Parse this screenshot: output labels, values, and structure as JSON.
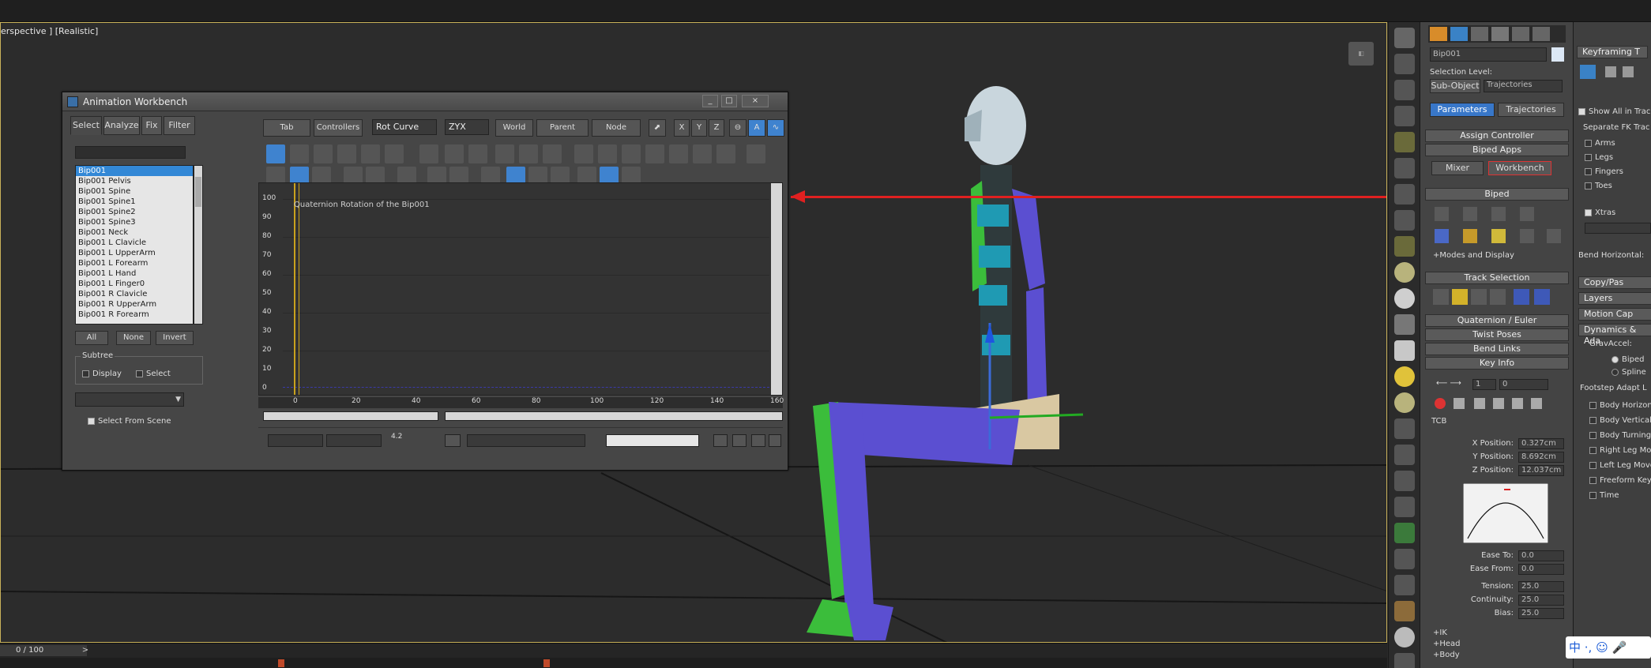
{
  "viewport": {
    "label": "erspective ] [Realistic]"
  },
  "workbench": {
    "title": "Animation Workbench",
    "window_buttons": [
      "_",
      "□",
      "×"
    ],
    "left_tabs": [
      "Select",
      "Analyze",
      "Fix",
      "Filter"
    ],
    "bones": [
      "Bip001",
      "Bip001 Pelvis",
      "Bip001 Spine",
      "Bip001 Spine1",
      "Bip001 Spine2",
      "Bip001 Spine3",
      "Bip001 Neck",
      "Bip001 L Clavicle",
      "Bip001 L UpperArm",
      "Bip001 L Forearm",
      "Bip001 L Hand",
      "Bip001 L Finger0",
      "Bip001 R Clavicle",
      "Bip001 R UpperArm",
      "Bip001 R Forearm"
    ],
    "list_buttons": {
      "all": "All",
      "none": "None",
      "invert": "Invert"
    },
    "subtree": {
      "caption": "Subtree",
      "display": "Display",
      "select": "Select"
    },
    "select_from_scene": "Select From Scene",
    "toolbar": {
      "tab": "Tab",
      "controllers": "Controllers",
      "curve_mode": "Rot Curve",
      "axis_order": "ZYX",
      "world": "World",
      "parent": "Parent",
      "node": "Node",
      "x": "X",
      "y": "Y",
      "z": "Z"
    },
    "graph": {
      "caption": "Quaternion Rotation of the Bip001",
      "y_ticks": [
        "100",
        "90",
        "80",
        "70",
        "60",
        "50",
        "40",
        "30",
        "20",
        "10",
        "0"
      ],
      "x_ticks": [
        "0",
        "20",
        "40",
        "60",
        "80",
        "100",
        "120",
        "140",
        "160"
      ]
    },
    "bottom_value": "4.2"
  },
  "biped_panel": {
    "object_name": "Bip001",
    "selection_level": "Selection Level:",
    "sub_object": "Sub-Object",
    "sub_object_value": "Trajectories",
    "tab_parameters": "Parameters",
    "tab_trajectories": "Trajectories",
    "rollouts": {
      "assign_controller": "Assign Controller",
      "biped_apps": "Biped Apps",
      "mixer": "Mixer",
      "workbench": "Workbench",
      "biped": "Biped",
      "modes_display": "+Modes and Display",
      "track_selection": "Track Selection",
      "quaternion_euler": "Quaternion / Euler",
      "twist_poses": "Twist Poses",
      "bend_links": "Bend Links",
      "key_info": "Key Info",
      "tcb": "TCB",
      "ik": "+IK",
      "head": "+Head",
      "body": "+Body"
    },
    "key_index": "1",
    "key_time": "0",
    "positions": {
      "x_label": "X Position:",
      "x_value": "0.327cm",
      "y_label": "Y Position:",
      "y_value": "8.692cm",
      "z_label": "Z Position:",
      "z_value": "12.037cm"
    },
    "tcb_values": {
      "ease_to_label": "Ease To:",
      "ease_to": "0.0",
      "ease_from_label": "Ease From:",
      "ease_from": "0.0",
      "tension_label": "Tension:",
      "tension": "25.0",
      "continuity_label": "Continuity:",
      "continuity": "25.0",
      "bias_label": "Bias:",
      "bias": "25.0"
    }
  },
  "side_panel": {
    "keyframing": "Keyframing T",
    "show_all": "Show All in Trac",
    "separate_fk": "Separate FK Trac",
    "fk_items": [
      "Arms",
      "Legs",
      "Fingers",
      "Toes"
    ],
    "xtras": "Xtras",
    "bend_horizontal": "Bend Horizontal:",
    "rollouts": [
      "Copy/Pas",
      "Layers",
      "Motion Cap",
      "Dynamics & Ada"
    ],
    "grav_accel": "GravAccel:",
    "biped_opt": "Biped",
    "spline_opt": "Spline",
    "footstep": "Footstep Adapt L",
    "footstep_items": [
      "Body Horizon",
      "Body Vertical",
      "Body Turning",
      "Right Leg Mov",
      "Left Leg Move",
      "Freeform Key",
      "Time"
    ]
  },
  "timeline": {
    "counter": "0 / 100",
    "next": ">"
  },
  "ime": {
    "label": "中 ·, ☺ 🎤"
  }
}
